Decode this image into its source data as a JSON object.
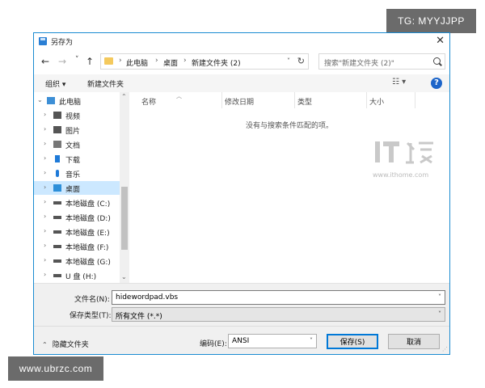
{
  "overlay": {
    "tg_badge": "TG: MYYJJPP",
    "site_badge": "www.ubrzc.com"
  },
  "dialog": {
    "title": "另存为",
    "nav": {
      "back": "←",
      "forward": "→",
      "recent": "˅",
      "up": "↑"
    },
    "breadcrumb": [
      "此电脑",
      "桌面",
      "新建文件夹 (2)"
    ],
    "breadcrumb_sep": "›",
    "search_placeholder": "搜索\"新建文件夹 (2)\"",
    "toolbar": {
      "organize": "组织 ▾",
      "new_folder": "新建文件夹",
      "view": "☷ ▾",
      "help": "?"
    },
    "nav_tree": [
      {
        "label": "此电脑",
        "icon": "computer-icon",
        "color": "#3d8fd6"
      },
      {
        "label": "视频",
        "icon": "video-folder-icon",
        "color": "#555555"
      },
      {
        "label": "图片",
        "icon": "pictures-folder-icon",
        "color": "#555555"
      },
      {
        "label": "文档",
        "icon": "documents-folder-icon",
        "color": "#777777"
      },
      {
        "label": "下载",
        "icon": "downloads-folder-icon",
        "color": "#1e7ad8"
      },
      {
        "label": "音乐",
        "icon": "music-folder-icon",
        "color": "#1e7ad8"
      },
      {
        "label": "桌面",
        "icon": "desktop-folder-icon",
        "color": "#2d8fd9",
        "selected": true
      },
      {
        "label": "本地磁盘 (C:)",
        "icon": "system-drive-icon",
        "color": "#555555"
      },
      {
        "label": "本地磁盘 (D:)",
        "icon": "drive-icon",
        "color": "#555555"
      },
      {
        "label": "本地磁盘 (E:)",
        "icon": "drive-icon",
        "color": "#555555"
      },
      {
        "label": "本地磁盘 (F:)",
        "icon": "drive-icon",
        "color": "#555555"
      },
      {
        "label": "本地磁盘 (G:)",
        "icon": "drive-icon",
        "color": "#555555"
      },
      {
        "label": "U 盘 (H:)",
        "icon": "usb-drive-icon",
        "color": "#555555"
      }
    ],
    "columns": [
      "名称",
      "修改日期",
      "类型",
      "大小"
    ],
    "empty_message": "没有与搜索条件匹配的项。",
    "watermark_url": "www.ithome.com",
    "filename_label": "文件名(N):",
    "filename_value": "hidewordpad.vbs",
    "filetype_label": "保存类型(T):",
    "filetype_value": "所有文件 (*.*)",
    "hide_folders": "隐藏文件夹",
    "encoding_label": "编码(E):",
    "encoding_value": "ANSI",
    "save_button": "保存(S)",
    "cancel_button": "取消"
  },
  "colors": {
    "accent": "#0078d7",
    "selection": "#cce8ff",
    "help_icon": "#1c64c9"
  }
}
